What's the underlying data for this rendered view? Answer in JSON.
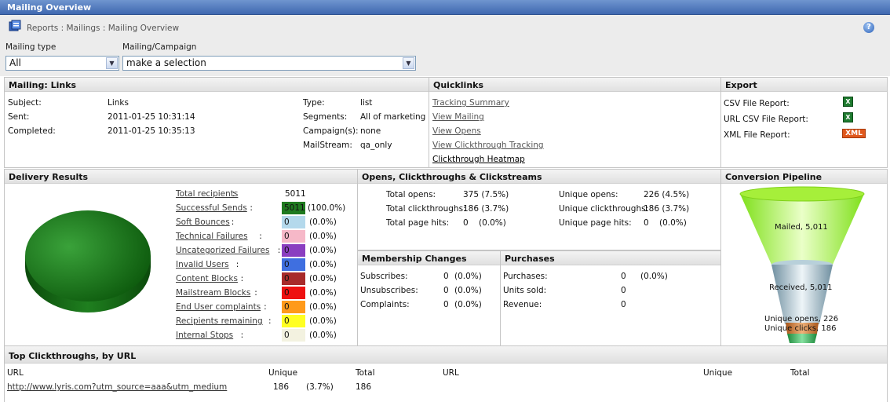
{
  "window": {
    "title": "Mailing Overview"
  },
  "breadcrumb": "Reports : Mailings : Mailing Overview",
  "filters": {
    "mailing_type_label": "Mailing type",
    "mailing_type_value": "All",
    "campaign_label": "Mailing/Campaign",
    "campaign_value": "make a selection"
  },
  "mailing": {
    "header": "Mailing: Links",
    "subject_label": "Subject:",
    "subject": "Links",
    "sent_label": "Sent:",
    "sent": "2011-01-25 10:31:14",
    "completed_label": "Completed:",
    "completed": "2011-01-25 10:35:13",
    "type_label": "Type:",
    "type": "list",
    "segments_label": "Segments:",
    "segments": "All of marketing",
    "campaigns_label": "Campaign(s):",
    "campaigns": "none",
    "mailstream_label": "MailStream:",
    "mailstream": "qa_only"
  },
  "quicklinks": {
    "header": "Quicklinks",
    "items": [
      "Tracking Summary",
      "View Mailing",
      "View Opens",
      "View Clickthrough Tracking",
      "Clickthrough Heatmap"
    ]
  },
  "export": {
    "header": "Export",
    "items": [
      "CSV File Report:",
      "URL CSV File Report:",
      "XML File Report:"
    ],
    "xml_badge": "XML"
  },
  "delivery": {
    "header": "Delivery Results",
    "total_label": "Total recipients",
    "total_value": "5011",
    "rows": [
      {
        "label": "Successful Sends",
        "value": "5011",
        "pct": "(100.0%)",
        "color": "#1f7a1f"
      },
      {
        "label": "Soft Bounces",
        "value": "0",
        "pct": "(0.0%)",
        "color": "#b4d9ec"
      },
      {
        "label": "Technical Failures",
        "value": "0",
        "pct": "(0.0%)",
        "color": "#f6b8c8"
      },
      {
        "label": "Uncategorized Failures",
        "value": "0",
        "pct": "(0.0%)",
        "color": "#8a3ec0"
      },
      {
        "label": "Invalid Users",
        "value": "0",
        "pct": "(0.0%)",
        "color": "#3f6fe0"
      },
      {
        "label": "Content Blocks",
        "value": "0",
        "pct": "(0.0%)",
        "color": "#a82a2a"
      },
      {
        "label": "Mailstream Blocks",
        "value": "0",
        "pct": "(0.0%)",
        "color": "#ee1111"
      },
      {
        "label": "End User complaints",
        "value": "0",
        "pct": "(0.0%)",
        "color": "#ff9a1a"
      },
      {
        "label": "Recipients remaining",
        "value": "0",
        "pct": "(0.0%)",
        "color": "#ffff22"
      },
      {
        "label": "Internal Stops",
        "value": "0",
        "pct": "(0.0%)",
        "color": "#f3f2e0"
      }
    ]
  },
  "opens": {
    "header": "Opens, Clickthroughs & Clickstreams",
    "total_opens_label": "Total opens:",
    "total_opens": "375 (7.5%)",
    "total_clicks_label": "Total clickthroughs:",
    "total_clicks": "186 (3.7%)",
    "total_hits_label": "Total page hits:",
    "total_hits": "0",
    "total_hits_pct": "(0.0%)",
    "unique_opens_label": "Unique opens:",
    "unique_opens": "226 (4.5%)",
    "unique_clicks_label": "Unique clickthroughs:",
    "unique_clicks": "186 (3.7%)",
    "unique_hits_label": "Unique page hits:",
    "unique_hits": "0",
    "unique_hits_pct": "(0.0%)"
  },
  "membership": {
    "header": "Membership Changes",
    "rows": [
      {
        "label": "Subscribes:",
        "value": "0",
        "pct": "(0.0%)"
      },
      {
        "label": "Unsubscribes:",
        "value": "0",
        "pct": "(0.0%)"
      },
      {
        "label": "Complaints:",
        "value": "0",
        "pct": "(0.0%)"
      }
    ]
  },
  "purchases": {
    "header": "Purchases",
    "purchases_label": "Purchases:",
    "purchases": "0",
    "purchases_pct": "(0.0%)",
    "units_label": "Units sold:",
    "units": "0",
    "revenue_label": "Revenue:",
    "revenue": "0"
  },
  "pipeline": {
    "header": "Conversion Pipeline",
    "mailed": "Mailed, 5,011",
    "received": "Received, 5,011",
    "unique_opens": "Unique opens, 226",
    "unique_clicks": "Unique clicks, 186"
  },
  "top_clicks": {
    "header": "Top Clickthroughs, by URL",
    "columns": [
      "URL",
      "Unique",
      "Total",
      "URL",
      "Unique",
      "Total"
    ],
    "rows": [
      {
        "url": "http://www.lyris.com?utm_source=aaa&utm_medium",
        "unique": "186",
        "pct": "(3.7%)",
        "total": "186"
      }
    ]
  }
}
